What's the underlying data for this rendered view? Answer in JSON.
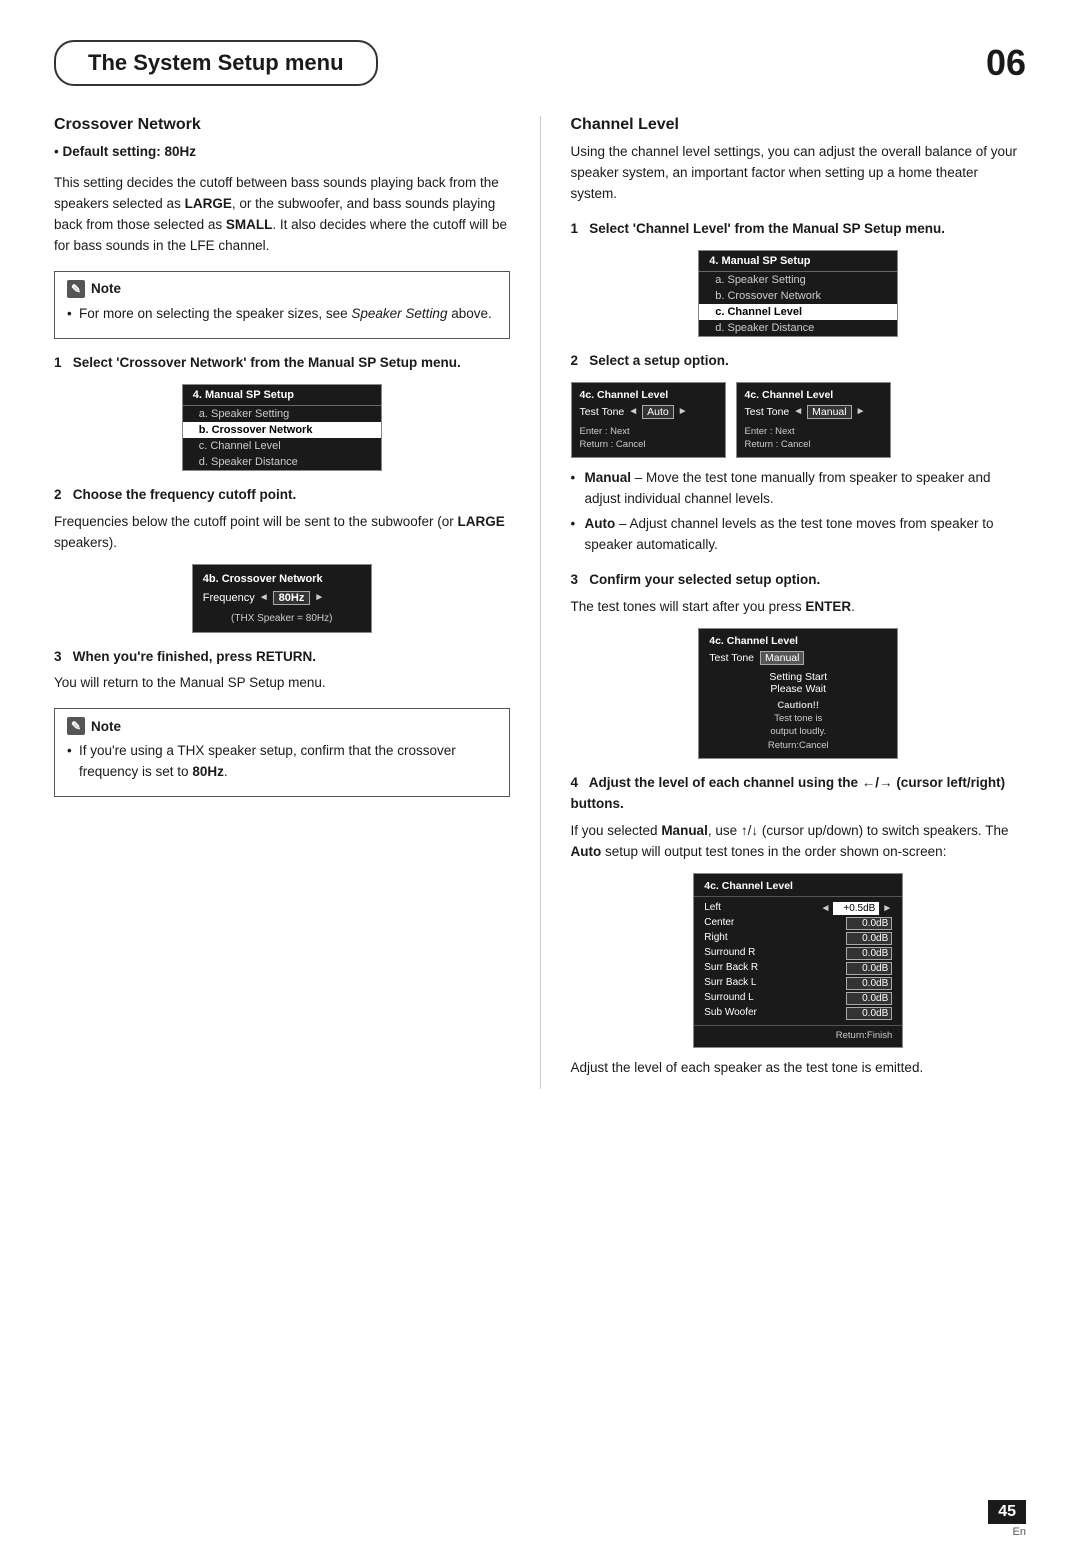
{
  "header": {
    "title": "The System Setup menu",
    "chapter": "06"
  },
  "left_section": {
    "title": "Crossover Network",
    "default_label": "Default setting:",
    "default_value": "80Hz",
    "body1": "This setting decides the cutoff between bass sounds playing back from the speakers selected as LARGE, or the subwoofer, and bass sounds playing back from those selected as SMALL. It also decides where the cutoff will be for bass sounds in the LFE channel.",
    "note": {
      "header": "Note",
      "items": [
        "For more on selecting the speaker sizes, see Speaker Setting above."
      ]
    },
    "step1_heading": "1   Select 'Crossover Network' from the Manual SP Setup menu.",
    "sp_setup_menu": {
      "title": "4. Manual SP Setup",
      "items": [
        {
          "label": "a. Speaker Setting",
          "selected": false
        },
        {
          "label": "b. Crossover Network",
          "selected": true
        },
        {
          "label": "c. Channel Level",
          "selected": false
        },
        {
          "label": "d. Speaker Distance",
          "selected": false
        }
      ]
    },
    "step2_heading": "2   Choose the frequency cutoff point.",
    "step2_body": "Frequencies below the cutoff point will be sent to the subwoofer (or LARGE speakers).",
    "freq_menu": {
      "title": "4b. Crossover Network",
      "freq_label": "Frequency",
      "freq_value": "80Hz",
      "footer": "(THX Speaker = 80Hz)"
    },
    "step3_heading": "3   When you're finished, press RETURN.",
    "step3_body": "You will return to the Manual SP Setup menu.",
    "note2": {
      "header": "Note",
      "items": [
        "If you're using a THX speaker setup, confirm that the crossover frequency is set to 80Hz."
      ]
    }
  },
  "right_section": {
    "title": "Channel Level",
    "body1": "Using the channel level settings, you can adjust the overall balance of your speaker system, an important factor when setting up a home theater system.",
    "step1_heading": "1   Select 'Channel Level' from the Manual SP Setup menu.",
    "sp_setup_menu": {
      "title": "4. Manual SP Setup",
      "items": [
        {
          "label": "a. Speaker Setting",
          "selected": false
        },
        {
          "label": "b. Crossover Network",
          "selected": false
        },
        {
          "label": "c. Channel Level",
          "selected": true
        },
        {
          "label": "d. Speaker Distance",
          "selected": false
        }
      ]
    },
    "step2_heading": "2   Select a setup option.",
    "channel_options": [
      {
        "title": "4c. Channel Level",
        "tone_label": "Test Tone",
        "tone_value": "Auto",
        "footer1": "Enter  : Next",
        "footer2": "Return : Cancel"
      },
      {
        "title": "4c. Channel Level",
        "tone_label": "Test Tone",
        "tone_value": "Manual",
        "footer1": "Enter  : Next",
        "footer2": "Return : Cancel"
      }
    ],
    "bullet_options": [
      "Manual – Move the test tone manually from speaker to speaker and adjust individual channel levels.",
      "Auto – Adjust channel levels as the test tone moves from speaker to speaker automatically."
    ],
    "step3_heading": "3   Confirm your selected setup option.",
    "step3_body": "The test tones will start after you press ENTER.",
    "manual_box": {
      "title": "4c. Channel Level",
      "tone_label": "Test Tone",
      "tone_value": "Manual",
      "status1": "Setting Start",
      "status2": "Please Wait",
      "caution_label": "Caution!!",
      "caution_text1": "Test tone is",
      "caution_text2": "output loudly.",
      "caution_footer": "Return:Cancel"
    },
    "step4_heading": "4   Adjust the level of each channel using the ←/→ (cursor left/right) buttons.",
    "step4_body": "If you selected Manual, use ↑/↓ (cursor up/down) to switch speakers. The Auto setup will output test tones in the order shown on-screen:",
    "cl_table": {
      "title": "4c. Channel Level",
      "rows": [
        {
          "name": "Left",
          "value": "+0.5dB",
          "highlight": true
        },
        {
          "name": "Center",
          "value": "0.0dB",
          "highlight": false
        },
        {
          "name": "Right",
          "value": "0.0dB",
          "highlight": false
        },
        {
          "name": "Surround R",
          "value": "0.0dB",
          "highlight": false
        },
        {
          "name": "Surr Back R",
          "value": "0.0dB",
          "highlight": false
        },
        {
          "name": "Surr Back L",
          "value": "0.0dB",
          "highlight": false
        },
        {
          "name": "Surround L",
          "value": "0.0dB",
          "highlight": false
        },
        {
          "name": "Sub Woofer",
          "value": "0.0dB",
          "highlight": false
        }
      ],
      "footer": "Return:Finish"
    },
    "step4_footer": "Adjust the level of each speaker as the test tone is emitted."
  },
  "footer": {
    "page_number": "45",
    "lang": "En"
  }
}
